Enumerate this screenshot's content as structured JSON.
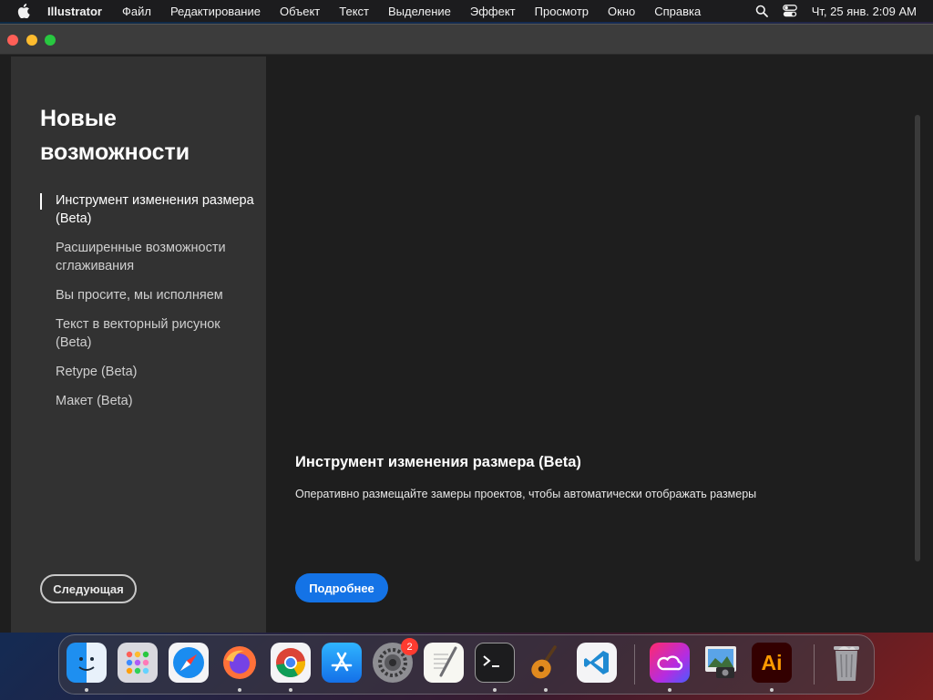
{
  "menubar": {
    "app_name": "Illustrator",
    "items": [
      "Файл",
      "Редактирование",
      "Объект",
      "Текст",
      "Выделение",
      "Эффект",
      "Просмотр",
      "Окно",
      "Справка"
    ],
    "clock": "Чт, 25 янв.  2:09 AM"
  },
  "sidebar": {
    "title": "Новые возможности",
    "items": [
      {
        "label": "Инструмент изменения размера (Beta)",
        "active": true
      },
      {
        "label": "Расширенные возможности сглаживания",
        "active": false
      },
      {
        "label": "Вы просите, мы исполняем",
        "active": false
      },
      {
        "label": "Текст в векторный рисунок (Beta)",
        "active": false
      },
      {
        "label": "Retype (Beta)",
        "active": false
      },
      {
        "label": "Макет (Beta)",
        "active": false
      }
    ],
    "next_label": "Следующая"
  },
  "content": {
    "feature_title": "Инструмент изменения размера (Beta)",
    "feature_description": "Оперативно размещайте замеры проектов, чтобы автоматически отображать размеры",
    "more_label": "Подробнее"
  },
  "dock": {
    "settings_badge": "2",
    "illustrator_label": "Ai",
    "icons": [
      "finder-icon",
      "launchpad-icon",
      "safari-icon",
      "firefox-icon",
      "chrome-icon",
      "app-store-icon",
      "system-settings-icon",
      "textedit-icon",
      "terminal-icon",
      "garageband-icon",
      "vscode-icon",
      "creative-cloud-icon",
      "preview-icon",
      "illustrator-icon",
      "trash-icon"
    ]
  },
  "colors": {
    "accent": "#1473e6",
    "sidebar_bg": "#323232",
    "content_bg": "#1e1e1e",
    "illustrator_orange": "#ff9a00"
  }
}
